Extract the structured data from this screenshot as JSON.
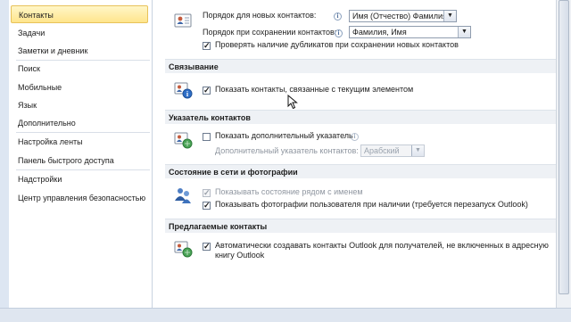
{
  "sidebar": {
    "items": [
      {
        "label": "Контакты"
      },
      {
        "label": "Задачи"
      },
      {
        "label": "Заметки и дневник"
      },
      {
        "label": "Поиск"
      },
      {
        "label": "Мобильные"
      },
      {
        "label": "Язык"
      },
      {
        "label": "Дополнительно"
      },
      {
        "label": "Настройка ленты"
      },
      {
        "label": "Панель быстрого доступа"
      },
      {
        "label": "Надстройки"
      },
      {
        "label": "Центр управления безопасностью"
      }
    ]
  },
  "names": {
    "new_order_label": "Порядок для новых контактов:",
    "new_order_value": "Имя (Отчество) Фамилия",
    "save_order_label": "Порядок при сохранении контактов:",
    "save_order_value": "Фамилия, Имя",
    "check_duplicates_label": "Проверять наличие дубликатов при сохранении новых контактов",
    "check_duplicates_checked": true
  },
  "linking": {
    "title": "Связывание",
    "show_linked_label": "Показать контакты, связанные с текущим элементом",
    "show_linked_checked": true
  },
  "indicator": {
    "title": "Указатель контактов",
    "show_additional_label": "Показать дополнительный указатель",
    "show_additional_checked": false,
    "additional_index_label": "Дополнительный указатель контактов:",
    "additional_index_value": "Арабский"
  },
  "presence": {
    "title": "Состояние в сети и фотографии",
    "show_status_label": "Показывать состояние рядом с именем",
    "show_status_checked": true,
    "show_photos_label": "Показывать фотографии пользователя при наличии (требуется перезапуск Outlook)",
    "show_photos_checked": true
  },
  "suggested": {
    "title": "Предлагаемые контакты",
    "auto_create_label_line1": "Автоматически создавать контакты Outlook для получателей, не включенных в адресную",
    "auto_create_label_line2": "книгу Outlook",
    "auto_create_checked": true
  },
  "icons": {
    "info": "i",
    "check": "✓",
    "dropdown_arrow": "▼"
  },
  "colors": {
    "active_item": "#ffe58c",
    "section_bg": "#eef1f5"
  }
}
